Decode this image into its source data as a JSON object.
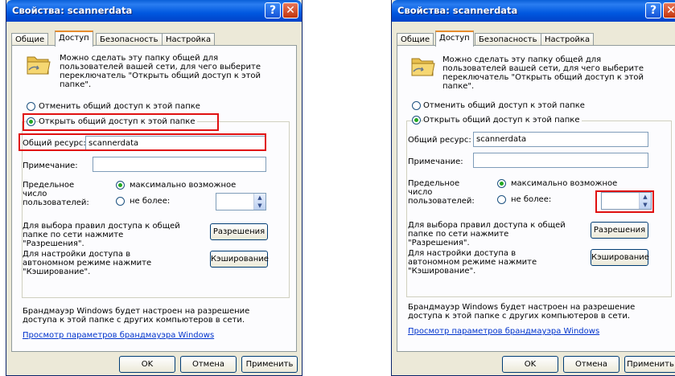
{
  "dialog": {
    "title": "Свойства: scannerdata",
    "help_glyph": "?",
    "close_glyph": "✕",
    "tabs": [
      "Общие",
      "Доступ",
      "Безопасность",
      "Настройка"
    ],
    "active_tab": "Доступ",
    "info_text": "Можно сделать эту папку общей для пользователей вашей сети, для чего выберите переключатель \"Открыть общий доступ к этой папке\".",
    "radio_no_share": "Отменить общий доступ к этой папке",
    "radio_share": "Открыть общий доступ к этой папке",
    "share_name_label": "Общий ресурс:",
    "share_name_value": "scannerdata",
    "comment_label": "Примечание:",
    "comment_value": "",
    "user_limit_label": "Предельное число пользователей:",
    "radio_max": "максимально возможное",
    "radio_no_more": "не более:",
    "user_limit_value": "",
    "permissions_text": "Для выбора правил доступа к общей папке по сети нажмите \"Разрешения\".",
    "permissions_button": "Разрешения",
    "caching_text": "Для настройки доступа в автономном режиме нажмите \"Кэширование\".",
    "caching_button": "Кэширование",
    "firewall_text": "Брандмауэр Windows будет настроен на разрешение доступа к этой папке с других компьютеров в сети.",
    "firewall_link": "Просмотр параметров брандмауэра Windows",
    "ok_button": "OK",
    "cancel_button": "Отмена",
    "apply_button": "Применить"
  },
  "colors": {
    "highlight_red": "#e01010",
    "titlebar_blue": "#0058e0",
    "dialog_bg": "#ece9d8"
  }
}
